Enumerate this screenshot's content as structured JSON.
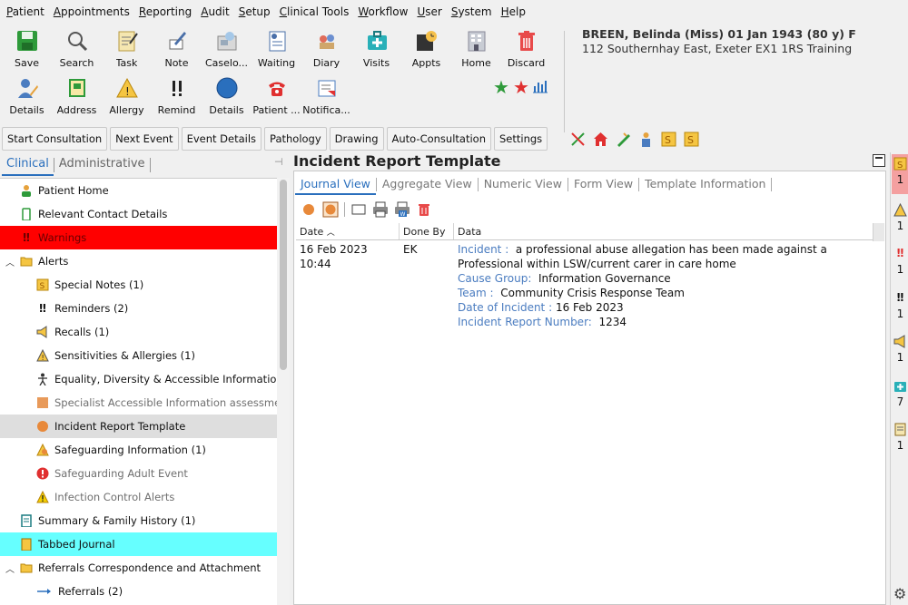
{
  "menu": [
    "Patient",
    "Appointments",
    "Reporting",
    "Audit",
    "Setup",
    "Clinical Tools",
    "Workflow",
    "User",
    "System",
    "Help"
  ],
  "toolbar_row1": [
    {
      "label": "Save",
      "icon": "save-icon"
    },
    {
      "label": "Search",
      "icon": "search-icon"
    },
    {
      "label": "Task",
      "icon": "task-icon"
    },
    {
      "label": "Note",
      "icon": "note-icon"
    },
    {
      "label": "Caselo...",
      "icon": "caseload-icon"
    },
    {
      "label": "Waiting",
      "icon": "waiting-icon"
    },
    {
      "label": "Diary",
      "icon": "diary-icon"
    },
    {
      "label": "Visits",
      "icon": "visits-icon"
    },
    {
      "label": "Appts",
      "icon": "appointments-icon"
    },
    {
      "label": "Home",
      "icon": "home-icon"
    },
    {
      "label": "Discard",
      "icon": "discard-icon"
    }
  ],
  "toolbar_row2": [
    {
      "label": "Details",
      "icon": "details-icon"
    },
    {
      "label": "Address",
      "icon": "address-icon"
    },
    {
      "label": "Allergy",
      "icon": "allergy-icon"
    },
    {
      "label": "Remind",
      "icon": "remind-icon"
    },
    {
      "label": "Details",
      "icon": "circle-details-icon"
    },
    {
      "label": "Patient ...",
      "icon": "patient-contact-icon"
    },
    {
      "label": "Notifica...",
      "icon": "notification-icon"
    }
  ],
  "patient": {
    "name": "BREEN, Belinda (Miss) 01 Jan 1943 (80 y) F",
    "address": "112 Southernhay East, Exeter EX1 1RS  Training"
  },
  "toolbar2": [
    "Start Consultation",
    "Next Event",
    "Event Details",
    "Pathology",
    "Drawing",
    "Auto-Consultation",
    "Settings"
  ],
  "left_tabs": [
    "Clinical",
    "Administrative"
  ],
  "tree": [
    {
      "label": "Patient Home",
      "lvl": 0,
      "icon": "person-icon"
    },
    {
      "label": "Relevant Contact Details",
      "lvl": 0,
      "icon": "phone-icon"
    },
    {
      "label": "Warnings",
      "lvl": 0,
      "icon": "exclamation-icon",
      "style": "warning"
    },
    {
      "label": "Alerts",
      "lvl": 0,
      "icon": "folder-icon",
      "expand": true
    },
    {
      "label": "Special Notes (1)",
      "lvl": 1,
      "icon": "special-notes-icon"
    },
    {
      "label": "Reminders (2)",
      "lvl": 1,
      "icon": "reminder-icon"
    },
    {
      "label": "Recalls (1)",
      "lvl": 1,
      "icon": "megaphone-icon"
    },
    {
      "label": "Sensitivities & Allergies (1)",
      "lvl": 1,
      "icon": "allergy-icon"
    },
    {
      "label": "Equality, Diversity & Accessible Information Needs",
      "lvl": 1,
      "icon": "accessibility-icon"
    },
    {
      "label": "Specialist Accessible Information assessment",
      "lvl": 1,
      "icon": "square-orange-icon",
      "style": "grey"
    },
    {
      "label": "Incident Report Template",
      "lvl": 1,
      "icon": "orange-dot-icon",
      "style": "selected"
    },
    {
      "label": "Safeguarding Information (1)",
      "lvl": 1,
      "icon": "safeguarding-icon"
    },
    {
      "label": "Safeguarding Adult Event",
      "lvl": 1,
      "icon": "red-alert-icon",
      "style": "grey"
    },
    {
      "label": "Infection Control Alerts",
      "lvl": 1,
      "icon": "warning-triangle-icon",
      "style": "grey"
    },
    {
      "label": "Summary & Family History (1)",
      "lvl": 0,
      "icon": "summary-icon"
    },
    {
      "label": "Tabbed Journal",
      "lvl": 0,
      "icon": "journal-icon",
      "style": "cyan"
    },
    {
      "label": "Referrals Correspondence and Attachment",
      "lvl": 0,
      "icon": "folder-icon",
      "expand": true
    },
    {
      "label": "Referrals (2)",
      "lvl": 1,
      "icon": "arrow-right-icon"
    }
  ],
  "main": {
    "title": "Incident Report Template",
    "tabs": [
      "Journal View",
      "Aggregate View",
      "Numeric View",
      "Form View",
      "Template Information"
    ],
    "columns": [
      "Date",
      "Done By",
      "Data"
    ],
    "row": {
      "date": "16 Feb 2023 10:44",
      "done_by": "EK",
      "fields": [
        {
          "key": "Incident :",
          "value": "a professional abuse allegation has been made against a Professional within LSW/current carer in care home"
        },
        {
          "key": "Cause Group:",
          "value": "Information Governance"
        },
        {
          "key": "Team :",
          "value": "Community Crisis Response Team"
        },
        {
          "key": "Date of Incident :",
          "value": "16 Feb 2023"
        },
        {
          "key": "Incident Report Number:",
          "value": "1234"
        }
      ]
    }
  },
  "right_strip": [
    "1",
    "1",
    "1",
    "1",
    "1",
    "7",
    "1"
  ],
  "colors": {
    "accent": "#2a6fbd",
    "warning": "#ff0000",
    "selected": "#dedede",
    "journal": "#66ffff"
  }
}
